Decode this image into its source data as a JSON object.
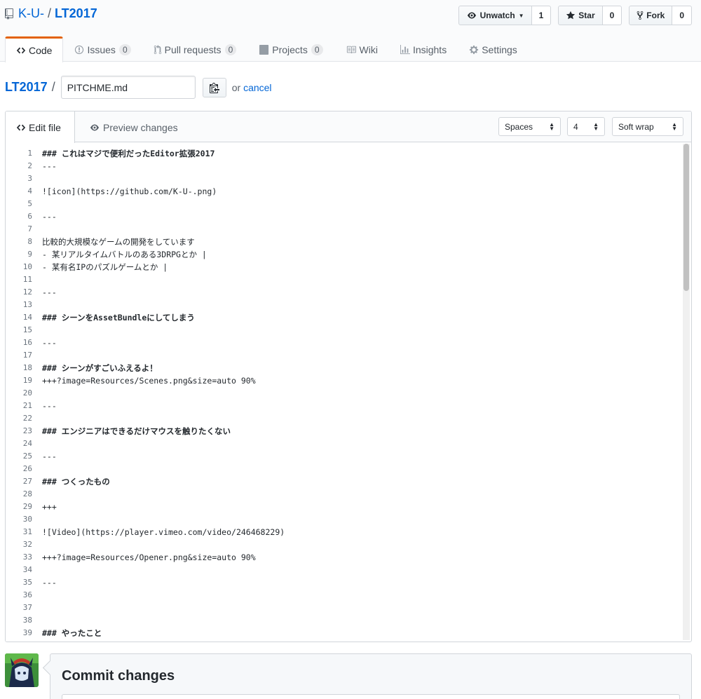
{
  "repo": {
    "owner": "K-U-",
    "separator": "/",
    "name": "LT2017"
  },
  "actions": {
    "watch_label": "Unwatch",
    "watch_count": "1",
    "star_label": "Star",
    "star_count": "0",
    "fork_label": "Fork",
    "fork_count": "0"
  },
  "nav": {
    "code": "Code",
    "issues": "Issues",
    "issues_count": "0",
    "pulls": "Pull requests",
    "pulls_count": "0",
    "projects": "Projects",
    "projects_count": "0",
    "wiki": "Wiki",
    "insights": "Insights",
    "settings": "Settings"
  },
  "breadcrumb": {
    "root": "LT2017",
    "slash": "/",
    "filename": "PITCHME.md",
    "or_text": "or",
    "cancel": "cancel"
  },
  "editor": {
    "tab_edit": "Edit file",
    "tab_preview": "Preview changes",
    "indent_mode": "Spaces",
    "indent_size": "4",
    "wrap_mode": "Soft wrap"
  },
  "code_lines": [
    "### これはマジで便利だったEditor拡張2017",
    "---",
    "",
    "![icon](https://github.com/K-U-.png)",
    "",
    "---",
    "",
    "比較的大規模なゲームの開発をしています",
    "- 某リアルタイムバトルのある3DRPGとか |",
    "- 某有名IPのパズルゲームとか |",
    "",
    "---",
    "",
    "### シーンをAssetBundleにしてしまう",
    "",
    "---",
    "",
    "### シーンがすごいふえるよ！",
    "+++?image=Resources/Scenes.png&size=auto 90%",
    "",
    "---",
    "",
    "### エンジニアはできるだけマウスを触りたくない",
    "",
    "---",
    "",
    "### つくったもの",
    "",
    "+++",
    "",
    "![Video](https://player.vimeo.com/video/246468229)",
    "",
    "+++?image=Resources/Opener.png&size=auto 90%",
    "",
    "---",
    "",
    "",
    "",
    "### やったこと",
    ""
  ],
  "commit": {
    "title": "Commit changes"
  }
}
